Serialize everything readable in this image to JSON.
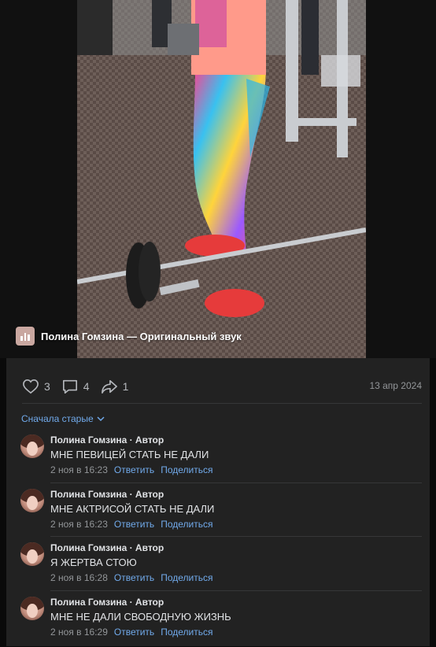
{
  "video": {
    "audio_label": "Полина Гомзина — Оригинальный звук"
  },
  "actions": {
    "likes": "3",
    "comments": "4",
    "shares": "1",
    "date": "13 апр 2024"
  },
  "sort_label": "Сначала старые",
  "comments": [
    {
      "author": "Полина Гомзина · Автор",
      "text": "МНЕ ПЕВИЦЕЙ СТАТЬ НЕ ДАЛИ",
      "time": "2 ноя в 16:23",
      "reply": "Ответить",
      "share": "Поделиться"
    },
    {
      "author": "Полина Гомзина · Автор",
      "text": "МНЕ АКТРИСОЙ СТАТЬ НЕ ДАЛИ",
      "time": "2 ноя в 16:23",
      "reply": "Ответить",
      "share": "Поделиться"
    },
    {
      "author": "Полина Гомзина · Автор",
      "text": "Я ЖЕРТВА СТОЮ",
      "time": "2 ноя в 16:28",
      "reply": "Ответить",
      "share": "Поделиться"
    },
    {
      "author": "Полина Гомзина · Автор",
      "text": "МНЕ НЕ ДАЛИ СВОБОДНУЮ ЖИЗНЬ",
      "time": "2 ноя в 16:29",
      "reply": "Ответить",
      "share": "Поделиться"
    }
  ]
}
